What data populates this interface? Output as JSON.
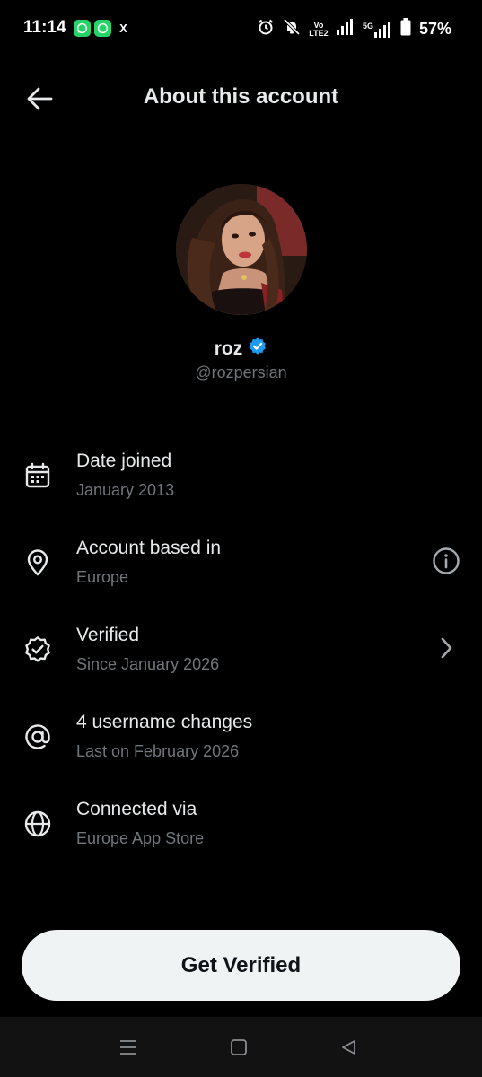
{
  "status_bar": {
    "time": "11:14",
    "notification_icons": [
      "whatsapp-icon",
      "whatsapp-icon",
      "x-icon"
    ],
    "x_glyph": "X",
    "volte_line1": "Vo",
    "volte_line2": "LTE2",
    "network_label": "5G",
    "battery_percent": "57%"
  },
  "header": {
    "title": "About this account"
  },
  "profile": {
    "display_name": "roz",
    "handle": "@rozpersian",
    "verified_badge_color": "#1d9bf0"
  },
  "info_rows": [
    {
      "icon": "calendar-icon",
      "title": "Date joined",
      "subtitle": "January 2013",
      "action": null
    },
    {
      "icon": "location-pin-icon",
      "title": "Account based in",
      "subtitle": "Europe",
      "action": "info-icon"
    },
    {
      "icon": "verified-badge-outline-icon",
      "title": "Verified",
      "subtitle": "Since January 2026",
      "action": "chevron-right-icon"
    },
    {
      "icon": "at-sign-icon",
      "title": "4 username changes",
      "subtitle": "Last on February 2026",
      "action": null
    },
    {
      "icon": "globe-icon",
      "title": "Connected via",
      "subtitle": "Europe App Store",
      "action": null
    }
  ],
  "cta": {
    "label": "Get Verified"
  },
  "nav_bar": {
    "buttons": [
      "menu-icon",
      "home-square-icon",
      "back-triangle-icon"
    ]
  },
  "colors": {
    "background": "#000000",
    "primary_text": "#e7e9ea",
    "secondary_text": "#71767b",
    "button_bg": "#eff3f4",
    "button_text": "#0f1419",
    "accent": "#1d9bf0"
  }
}
